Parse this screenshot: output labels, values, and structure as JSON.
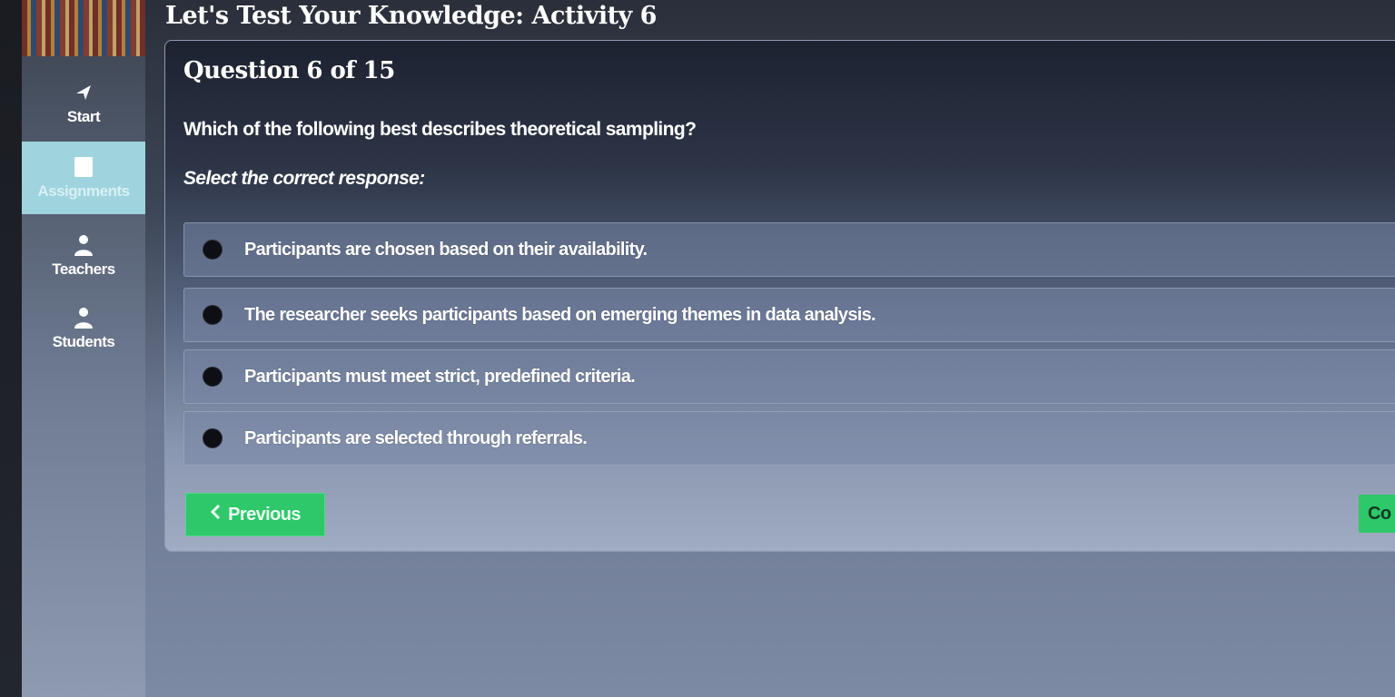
{
  "header": {
    "title": "Let's Test Your Knowledge: Activity 6"
  },
  "sidebar": {
    "items": [
      {
        "label": "Start",
        "icon": "arrow-icon"
      },
      {
        "label": "Assignments",
        "icon": "document-icon"
      },
      {
        "label": "Teachers",
        "icon": "person-icon"
      },
      {
        "label": "Students",
        "icon": "person-icon"
      }
    ]
  },
  "question": {
    "counter": "Question 6 of 15",
    "text": "Which of the following best describes theoretical sampling?",
    "instruction": "Select the correct response:",
    "options": [
      "Participants are chosen based on their availability.",
      "The researcher seeks participants based on emerging themes in data analysis.",
      "Participants must meet strict, predefined criteria.",
      "Participants are selected through referrals."
    ]
  },
  "nav": {
    "previous_label": "Previous",
    "next_label": "Co"
  },
  "colors": {
    "accent": "#2ec86a",
    "active_nav": "#9fd4de"
  }
}
